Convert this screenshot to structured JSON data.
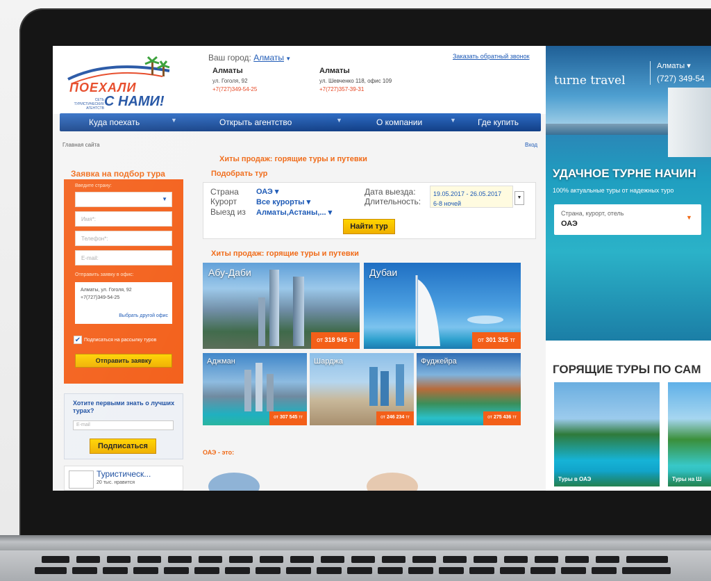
{
  "site": {
    "logo": {
      "line1": "ПОЕХАЛИ",
      "line2": "С НАМИ!",
      "small": "СЕТЬ ТУРИСТИЧЕСКИХ АГЕНТСТВ"
    },
    "city_label": "Ваш город:",
    "city_value": "Алматы",
    "callback": "Заказать обратный звонок",
    "offices": [
      {
        "city": "Алматы",
        "address": "ул. Гоголя, 92",
        "phone": "+7(727)349-54-25"
      },
      {
        "city": "Алматы",
        "address": "ул. Шевченко 118, офис 109",
        "phone": "+7(727)357-39-31"
      }
    ],
    "nav": [
      "Куда поехать",
      "Открыть агентство",
      "О компании",
      "Где купить"
    ],
    "breadcrumb": "Главная сайта",
    "login": "Вход",
    "hits_title": "Хиты продаж: горящие туры и путевки",
    "form": {
      "title": "Заявка на подбор тура",
      "country_label": "Введите страну:",
      "name_ph": "Имя*:",
      "phone_ph": "Телефон*:",
      "email_ph": "E-mail:",
      "office_label": "Отправить заявку в офис:",
      "office_address": "Алматы, ул. Гоголя, 92",
      "office_phone": "+7(727)349-54-25",
      "other_office": "Выбрать другой офис",
      "subscribe": "Подписаться на рассылку туров",
      "send": "Отправить заявку"
    },
    "newsletter": {
      "title": "Хотите первыми знать о лучших турах?",
      "email_ph": "E-mail",
      "button": "Подписаться"
    },
    "social": {
      "title": "Туристическ...",
      "subtitle": "20 тыс. нравится"
    },
    "search": {
      "title": "Подобрать тур",
      "country_label": "Страна",
      "country_value": "ОАЭ",
      "resort_label": "Курорт",
      "resort_value": "Все курорты",
      "from_label": "Выезд из",
      "from_value": "Алматы,Астаны,...",
      "date_label": "Дата выезда:",
      "date_value": "19.05.2017 - 26.05.2017",
      "duration_label": "Длительность:",
      "duration_value": "6-8 ночей",
      "button": "Найти тур"
    },
    "hits_title2": "Хиты продаж: горящие туры и путевки",
    "tours": [
      {
        "name": "Абу-Даби",
        "price_prefix": "от",
        "price": "318 945",
        "currency": "тг"
      },
      {
        "name": "Дубаи",
        "price_prefix": "от",
        "price": "301 325",
        "currency": "тг"
      },
      {
        "name": "Аджман",
        "price_prefix": "от",
        "price": "307 545",
        "currency": "тг"
      },
      {
        "name": "Шарджа",
        "price_prefix": "от",
        "price": "246 234",
        "currency": "тг"
      },
      {
        "name": "Фуджейра",
        "price_prefix": "от",
        "price": "275 436",
        "currency": "тг"
      }
    ],
    "uae_title": "ОАЭ - это:"
  },
  "right": {
    "brand": "turne travel",
    "city": "Алматы",
    "phone": "(727) 349-54",
    "hero_title": "УДАЧНОЕ ТУРНЕ НАЧИН",
    "hero_sub": "100% актуальные туры от надежных туро",
    "search_label": "Страна, курорт, отель",
    "search_value": "ОАЭ",
    "hot_title": "ГОРЯЩИЕ ТУРЫ ПО САМ",
    "cards": [
      "Туры в ОАЭ",
      "Туры на Ш"
    ]
  }
}
